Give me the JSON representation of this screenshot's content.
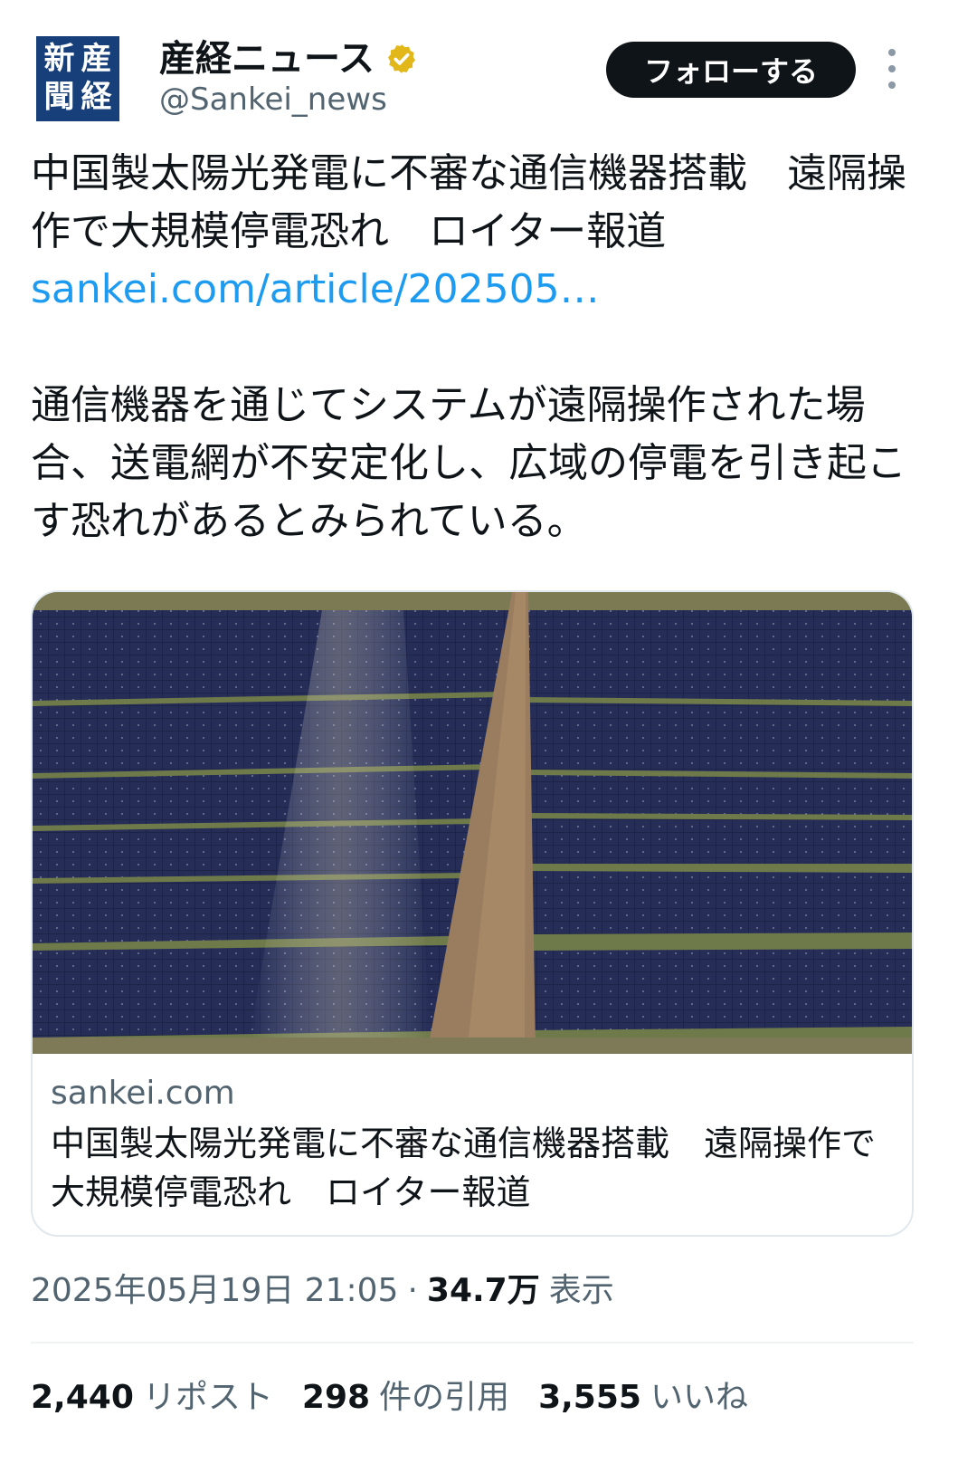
{
  "header": {
    "avatar_chars": [
      "新",
      "産",
      "聞",
      "経"
    ],
    "display_name": "産経ニュース",
    "handle": "@Sankei_news",
    "follow_label": "フォローする"
  },
  "tweet": {
    "text_line1": "中国製太陽光発電に不審な通信機器搭載　遠隔操作で大規模停電恐れ　ロイター報道",
    "link": "sankei.com/article/202505…",
    "text_body": "通信機器を通じてシステムが遠隔操作された場合、送電網が不安定化し、広域の停電を引き起こす恐れがあるとみられている。"
  },
  "card": {
    "domain": "sankei.com",
    "title": "中国製太陽光発電に不審な通信機器搭載　遠隔操作で大規模停電恐れ　ロイター報道"
  },
  "meta": {
    "timestamp": "2025年05月19日 21:05",
    "separator": "·",
    "views": "34.7万",
    "views_label": "表示"
  },
  "stats": {
    "reposts": "2,440",
    "reposts_label": "リポスト",
    "quotes": "298",
    "quotes_label": "件の引用",
    "likes": "3,555",
    "likes_label": "いいね"
  },
  "colors": {
    "link": "#1d9bf0",
    "verified": "#e2b719",
    "avatar_bg": "#17407a"
  }
}
